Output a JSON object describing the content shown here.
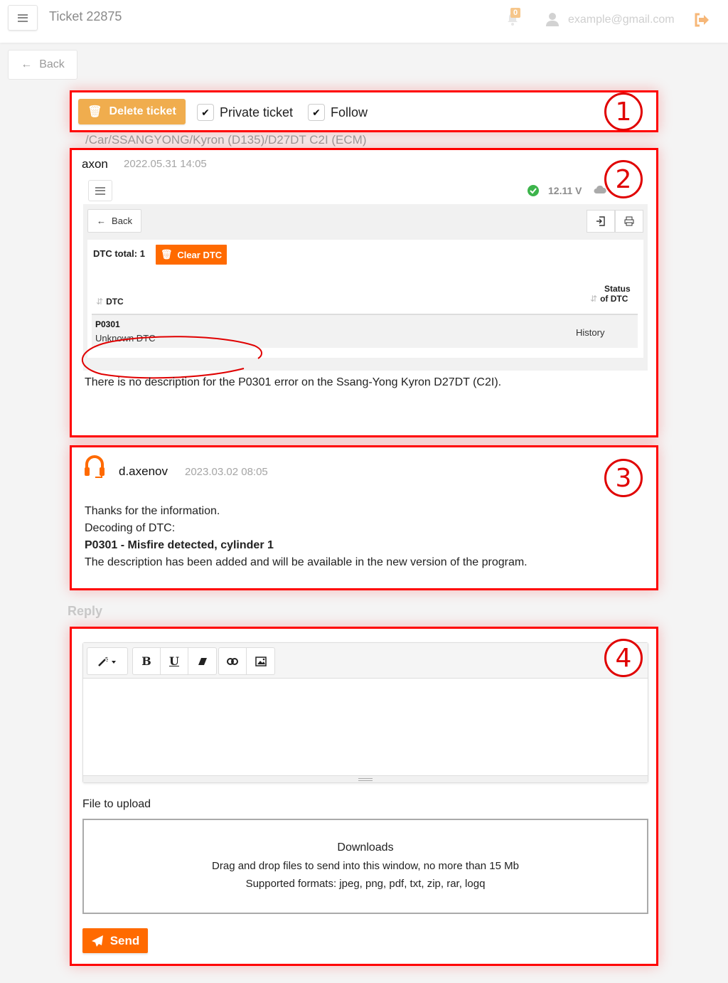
{
  "header": {
    "title": "Ticket 22875",
    "notification_count": "0",
    "user_email": "example@gmail.com"
  },
  "nav": {
    "back_label": "Back"
  },
  "annotations": [
    "1",
    "2",
    "3",
    "4"
  ],
  "ticket_actions": {
    "delete_label": "Delete ticket",
    "private_label": "Private ticket",
    "private_checked": true,
    "follow_label": "Follow",
    "follow_checked": true,
    "check_glyph": "✔"
  },
  "ticket_path": "/Car/SSANGYONG/Kyron (D135)/D27DT C2I (ECM)",
  "first_post": {
    "author": "axon",
    "timestamp": "2022.05.31 14:05",
    "screenshot": {
      "voltage": "12.11 V",
      "back_label": "Back",
      "dtc_total": "DTC total: 1",
      "clear_label": "Clear DTC",
      "columns": {
        "dtc": "DTC",
        "status_line1": "Status",
        "status_line2": "of DTC"
      },
      "rows": [
        {
          "code": "P0301",
          "description": "Unknown DTC",
          "status": "History"
        }
      ]
    },
    "message": "There is no description for the P0301 error on the Ssang-Yong Kyron D27DT (C2I)."
  },
  "reply_post": {
    "author": "d.axenov",
    "timestamp": "2023.03.02 08:05",
    "lines": [
      "Thanks for the information.",
      "Decoding of DTC:",
      "P0301 - Misfire detected, cylinder 1",
      "The description has been added and will be available in the new version of the program."
    ]
  },
  "reply_form": {
    "section_label": "Reply",
    "toolbar": {
      "bold": "B",
      "underline": "U"
    },
    "editor_value": "",
    "file_label": "File to upload",
    "dropzone": {
      "title": "Downloads",
      "line1": "Drag and drop files to send into this window, no more than 15 Mb",
      "line2": "Supported formats: jpeg, png, pdf, txt, zip, rar, logq"
    },
    "send_label": "Send"
  },
  "colors": {
    "accent_orange": "#ff6a00",
    "delete_orange": "#f0ad4e",
    "annotation_red": "#ff0000",
    "ok_green": "#3cb44b"
  }
}
